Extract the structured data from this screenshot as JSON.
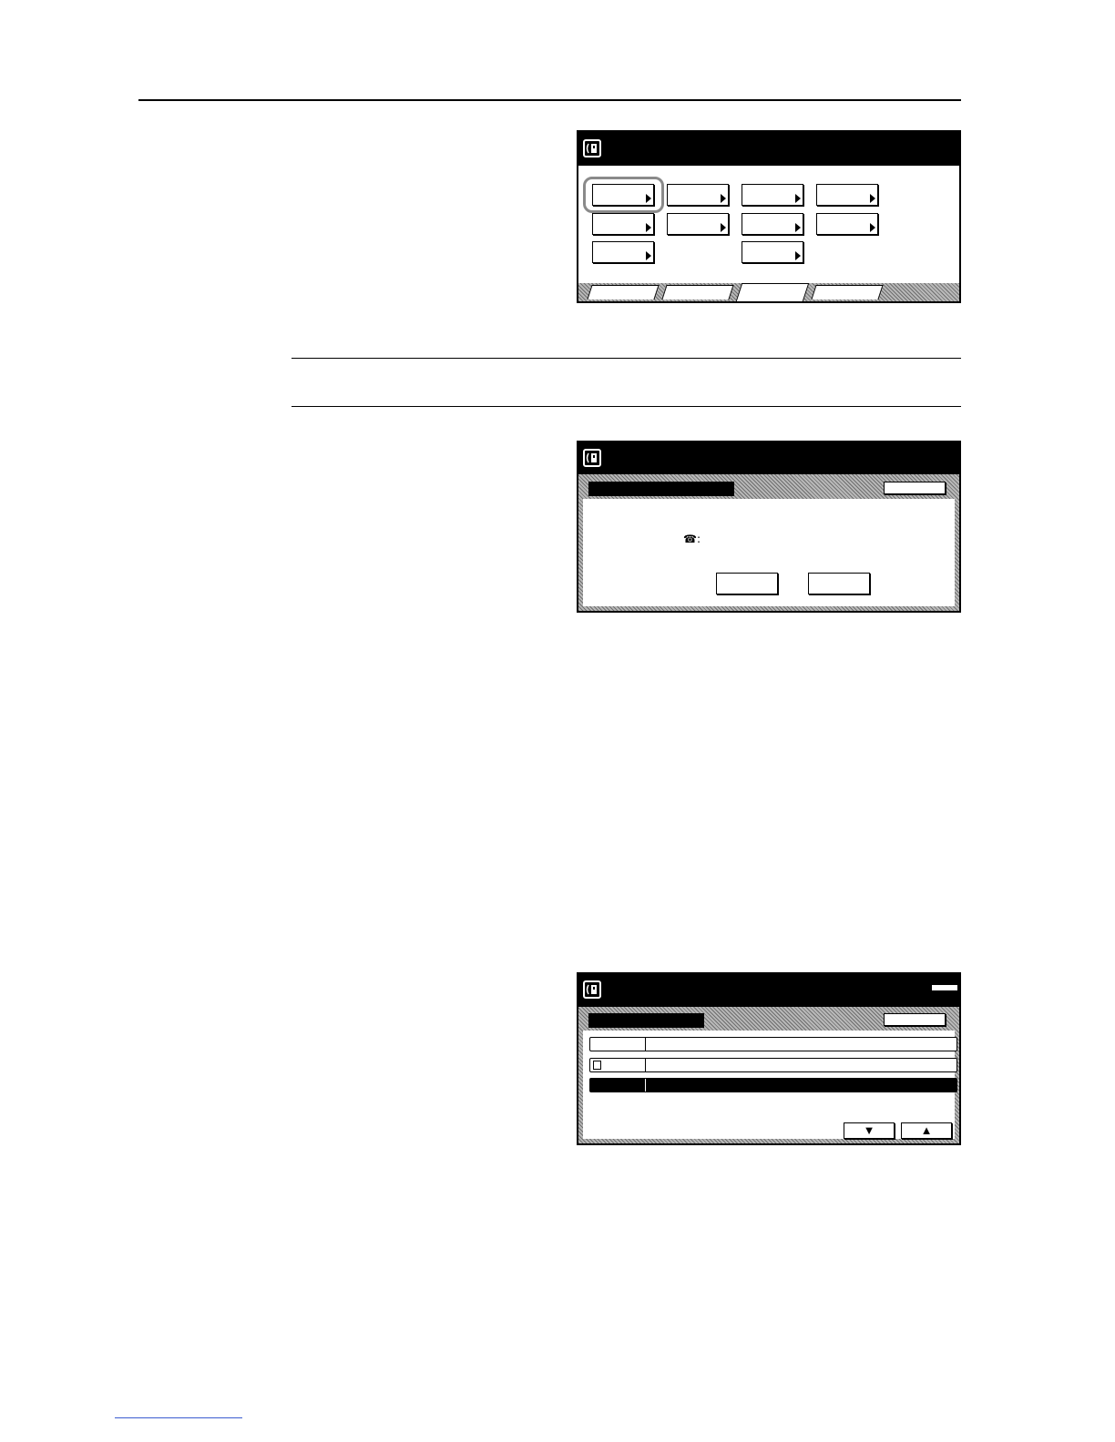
{
  "page": {
    "header_rule": "visible",
    "note_rules": "visible",
    "footnote_link_line": "visible"
  },
  "screen_main": {
    "title_icon": "fax-icon",
    "keys": [
      {
        "name": "key-1-1",
        "icon": "triangle-right-icon",
        "selected": true
      },
      {
        "name": "key-1-2",
        "icon": "triangle-right-icon"
      },
      {
        "name": "key-1-3",
        "icon": "triangle-right-icon"
      },
      {
        "name": "key-1-4",
        "icon": "triangle-right-icon"
      },
      {
        "name": "key-2-1",
        "icon": "triangle-right-icon"
      },
      {
        "name": "key-2-2",
        "icon": "triangle-right-icon"
      },
      {
        "name": "key-2-3",
        "icon": "triangle-right-icon"
      },
      {
        "name": "key-2-4",
        "icon": "triangle-right-icon"
      },
      {
        "name": "key-3-1",
        "icon": "triangle-right-icon"
      },
      {
        "name": "key-3-3",
        "icon": "triangle-right-icon"
      }
    ],
    "tabs": 4,
    "active_tab": 3
  },
  "screen_dialog": {
    "title_icon": "fax-icon",
    "phone_symbol": "☎:",
    "buttons": 2
  },
  "screen_list": {
    "title_icon": "fax-icon",
    "rows": 3,
    "selected_row": 3,
    "arrows": {
      "down": "▼",
      "up": "▲"
    }
  },
  "colors": {
    "accent": "#000000",
    "focus_ring": "#8a8a8a",
    "footnote_line": "#3a5bd0"
  }
}
